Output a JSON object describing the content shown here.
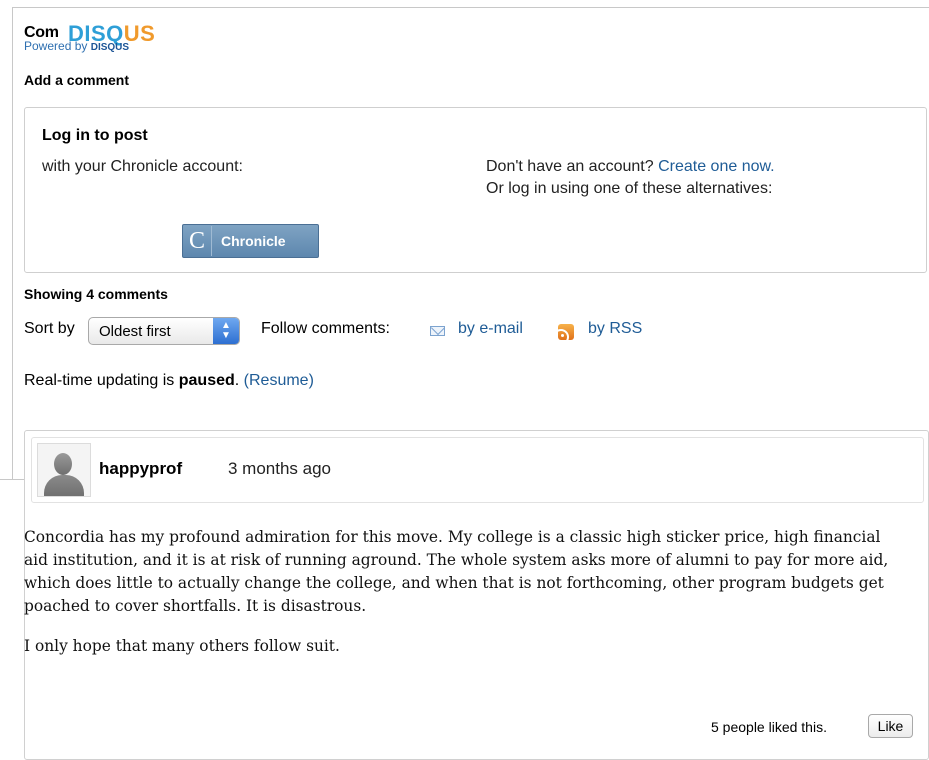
{
  "header": {
    "title": "Com",
    "logo_main": "DISQ",
    "logo_accent": "US",
    "powered_text": "Powered by",
    "powered_brand": "DISQUS"
  },
  "add_comment": "Add a comment",
  "login": {
    "title": "Log in to post",
    "subtitle": "with your Chronicle account:",
    "no_account": "Don't have an account?",
    "create_link": "Create one now.",
    "alternatives": "Or log in using one of these alternatives:",
    "chronicle_letter": "C",
    "chronicle_label": "Chronicle"
  },
  "thread": {
    "showing": "Showing 4 comments",
    "sort_label": "Sort by",
    "sort_value": "Oldest first",
    "follow_label": "Follow comments:",
    "by_email": "by e-mail",
    "by_rss": "by RSS",
    "realtime_prefix": "Real-time updating is",
    "realtime_state": "paused",
    "realtime_suffix": ".",
    "resume_link": "(Resume)"
  },
  "comments": [
    {
      "author": "happyprof",
      "time": "3 months ago",
      "paragraphs": [
        "Concordia has my profound admiration for this move.  My college is a classic high sticker price, high financial aid institution, and it is at risk of running aground.  The whole system asks more of alumni to pay for more aid, which does little to actually change the college, and when that is not forthcoming, other program budgets get poached to cover shortfalls.  It is disastrous.",
        "I only hope that many others follow suit."
      ],
      "likes_text": "5 people liked this.",
      "like_label": "Like"
    }
  ],
  "icons": {
    "mail": "mail-icon",
    "rss": "rss-icon",
    "avatar": "default-avatar"
  },
  "colors": {
    "link": "#1f5c96",
    "disqus_blue": "#2e9fd7",
    "disqus_orange": "#f09a2c",
    "chronicle_button": "#6a90b6"
  }
}
